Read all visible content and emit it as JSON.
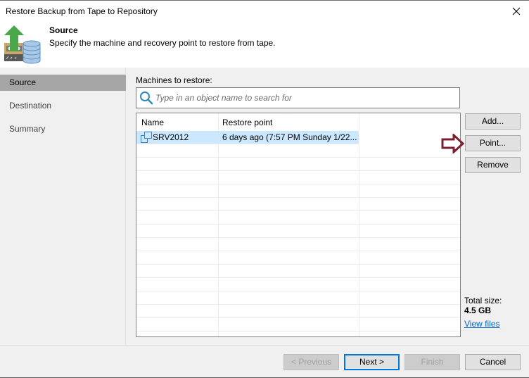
{
  "window": {
    "title": "Restore Backup from Tape to Repository",
    "close_icon": "close-icon"
  },
  "header": {
    "icon": "tape-to-repository-restore-icon",
    "title": "Source",
    "description": "Specify the machine and recovery point to restore from tape."
  },
  "sidebar": {
    "items": [
      {
        "label": "Source",
        "active": true
      },
      {
        "label": "Destination",
        "active": false
      },
      {
        "label": "Summary",
        "active": false
      }
    ]
  },
  "main": {
    "machines_label": "Machines to restore:",
    "search": {
      "placeholder": "Type in an object name to search for",
      "value": "",
      "icon": "search-icon"
    },
    "list": {
      "columns": [
        {
          "label": "Name"
        },
        {
          "label": "Restore point",
          "sorted": "ascending"
        }
      ],
      "rows": [
        {
          "name": "SRV2012",
          "restore_point": "6 days ago (7:57 PM Sunday 1/22...",
          "icon": "vm-icon",
          "selected": true
        }
      ]
    },
    "buttons": {
      "add": "Add...",
      "point": "Point...",
      "remove": "Remove"
    },
    "total_size_label": "Total size:",
    "total_size_value": "4.5 GB",
    "view_files_link": "View files"
  },
  "footer": {
    "previous": "< Previous",
    "next": "Next >",
    "finish": "Finish",
    "cancel": "Cancel"
  },
  "annotation": {
    "arrow_color": "#7b1f2e",
    "points_to": "Point..."
  }
}
